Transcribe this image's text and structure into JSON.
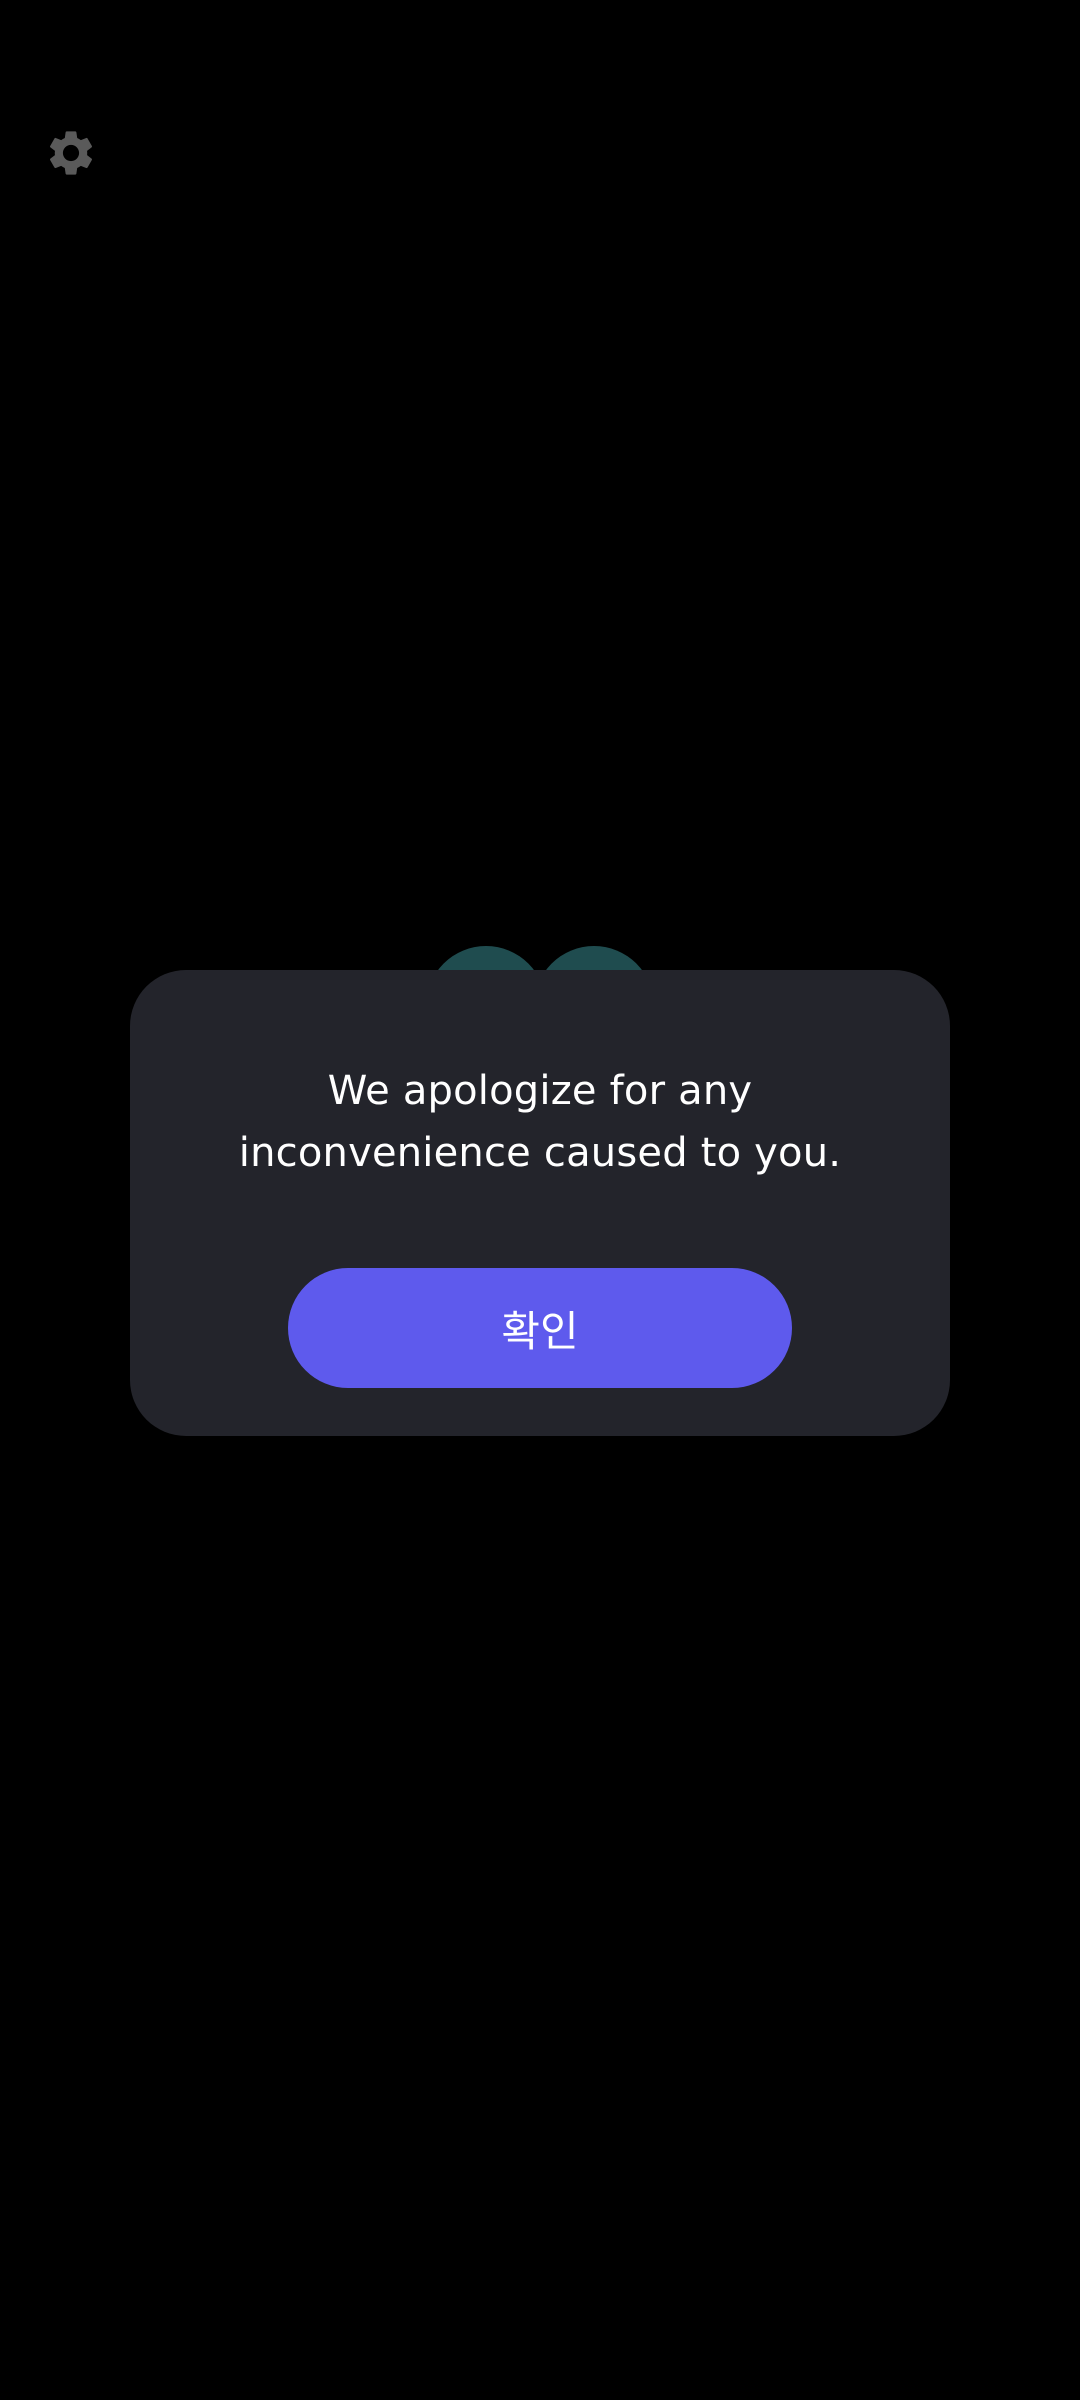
{
  "screen": {
    "background": "#000000"
  },
  "settings": {
    "icon": "gear-icon",
    "color": "#5a5a5a"
  },
  "dialog": {
    "message": "We apologize for any\ninconvenience caused to you.",
    "confirm_label": "확인",
    "background": "#23242b",
    "button_color": "#5e5aed"
  },
  "background_decor": {
    "circle_color": "#1f4c4f"
  }
}
